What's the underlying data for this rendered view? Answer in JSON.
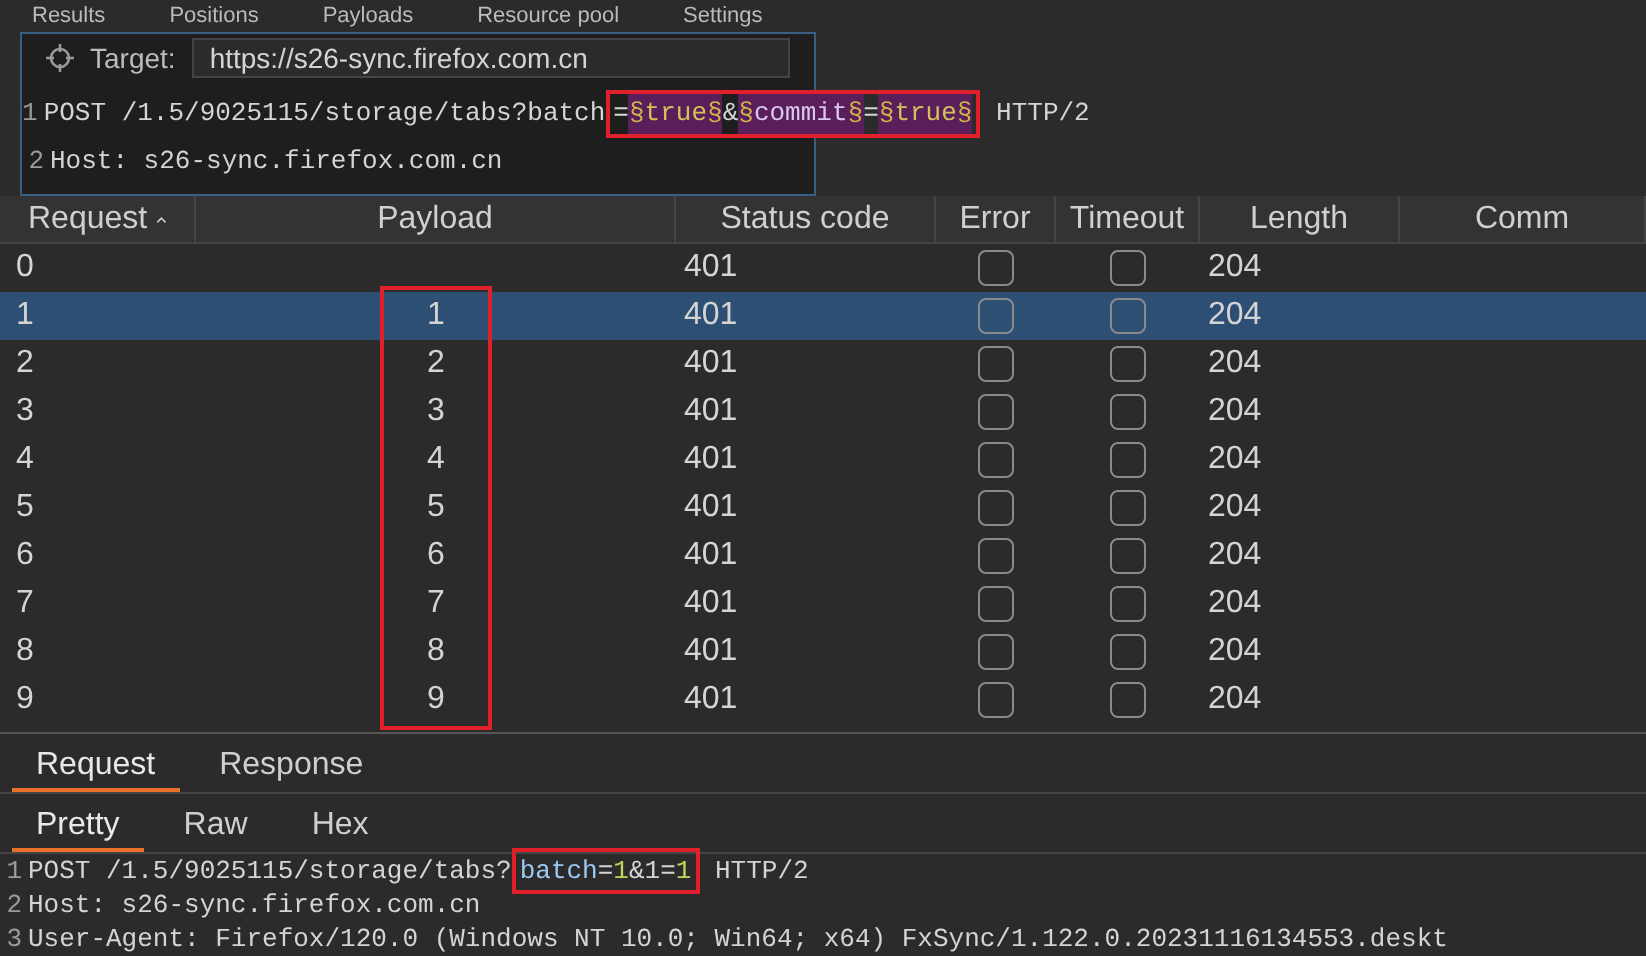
{
  "tool_tabs": [
    {
      "label": "Results"
    },
    {
      "label": "Positions"
    },
    {
      "label": "Payloads"
    },
    {
      "label": "Resource pool"
    },
    {
      "label": "Settings"
    }
  ],
  "target": {
    "label": "Target:",
    "value": "https://s26-sync.firefox.com.cn"
  },
  "template_editor": {
    "lines": [
      {
        "number": "1",
        "segments": [
          {
            "kind": "plain",
            "text": "POST /1.5/9025115/storage/tabs?batch"
          },
          {
            "kind": "boxed",
            "segments": [
              {
                "kind": "plain",
                "text": "="
              },
              {
                "kind": "marker",
                "text": "§"
              },
              {
                "kind": "payload",
                "text": "true"
              },
              {
                "kind": "marker",
                "text": "§"
              },
              {
                "kind": "plain",
                "text": "&"
              },
              {
                "kind": "marker",
                "text": "§"
              },
              {
                "kind": "name",
                "text": "commit"
              },
              {
                "kind": "marker",
                "text": "§"
              },
              {
                "kind": "plain",
                "text": "="
              },
              {
                "kind": "marker",
                "text": "§"
              },
              {
                "kind": "payload",
                "text": "true"
              },
              {
                "kind": "marker",
                "text": "§"
              }
            ]
          },
          {
            "kind": "plain",
            "text": " HTTP/2"
          }
        ]
      },
      {
        "number": "2",
        "segments": [
          {
            "kind": "plain",
            "text": "Host: s26-sync.firefox.com.cn"
          }
        ]
      }
    ]
  },
  "results_table": {
    "columns": [
      {
        "label": "Request",
        "sorted": true,
        "highlighted": false
      },
      {
        "label": "Payload",
        "sorted": false,
        "highlighted": true
      },
      {
        "label": "Status code",
        "sorted": false,
        "highlighted": false
      },
      {
        "label": "Error",
        "sorted": false,
        "highlighted": false
      },
      {
        "label": "Timeout",
        "sorted": false,
        "highlighted": false
      },
      {
        "label": "Length",
        "sorted": false,
        "highlighted": false
      },
      {
        "label": "Comm",
        "sorted": false,
        "highlighted": false
      }
    ],
    "rows": [
      {
        "request": "0",
        "status_code": "401",
        "error": false,
        "timeout": false,
        "length": "204",
        "selected": false
      },
      {
        "request": "1",
        "payload": "1",
        "status_code": "401",
        "error": false,
        "timeout": false,
        "length": "204",
        "selected": true
      },
      {
        "request": "2",
        "payload": "2",
        "status_code": "401",
        "error": false,
        "timeout": false,
        "length": "204",
        "selected": false
      },
      {
        "request": "3",
        "payload": "3",
        "status_code": "401",
        "error": false,
        "timeout": false,
        "length": "204",
        "selected": false
      },
      {
        "request": "4",
        "payload": "4",
        "status_code": "401",
        "error": false,
        "timeout": false,
        "length": "204",
        "selected": false
      },
      {
        "request": "5",
        "payload": "5",
        "status_code": "401",
        "error": false,
        "timeout": false,
        "length": "204",
        "selected": false
      },
      {
        "request": "6",
        "payload": "6",
        "status_code": "401",
        "error": false,
        "timeout": false,
        "length": "204",
        "selected": false
      },
      {
        "request": "7",
        "payload": "7",
        "status_code": "401",
        "error": false,
        "timeout": false,
        "length": "204",
        "selected": false
      },
      {
        "request": "8",
        "payload": "8",
        "status_code": "401",
        "error": false,
        "timeout": false,
        "length": "204",
        "selected": false
      },
      {
        "request": "9",
        "payload": "9",
        "status_code": "401",
        "error": false,
        "timeout": false,
        "length": "204",
        "selected": false
      }
    ]
  },
  "message_tabs": [
    {
      "label": "Request",
      "selected": true
    },
    {
      "label": "Response",
      "selected": false
    }
  ],
  "view_tabs": [
    {
      "label": "Pretty",
      "selected": true
    },
    {
      "label": "Raw",
      "selected": false
    },
    {
      "label": "Hex",
      "selected": false
    }
  ],
  "message_editor": {
    "lines": [
      {
        "number": "1",
        "segments": [
          {
            "kind": "plain",
            "text": "POST /1.5/9025115/storage/tabs?"
          },
          {
            "kind": "boxed",
            "segments": [
              {
                "kind": "name",
                "text": "batch"
              },
              {
                "kind": "plain",
                "text": "="
              },
              {
                "kind": "payload",
                "text": "1"
              },
              {
                "kind": "plain",
                "text": "&1="
              },
              {
                "kind": "payload",
                "text": "1"
              }
            ]
          },
          {
            "kind": "plain",
            "text": " HTTP/2"
          }
        ]
      },
      {
        "number": "2",
        "segments": [
          {
            "kind": "plain",
            "text": "Host: s26-sync.firefox.com.cn"
          }
        ]
      },
      {
        "number": "3",
        "segments": [
          {
            "kind": "plain",
            "text": "User-Agent: Firefox/120.0 (Windows NT 10.0; Win64; x64) FxSync/1.122.0.20231116134553.deskt"
          }
        ]
      }
    ]
  }
}
